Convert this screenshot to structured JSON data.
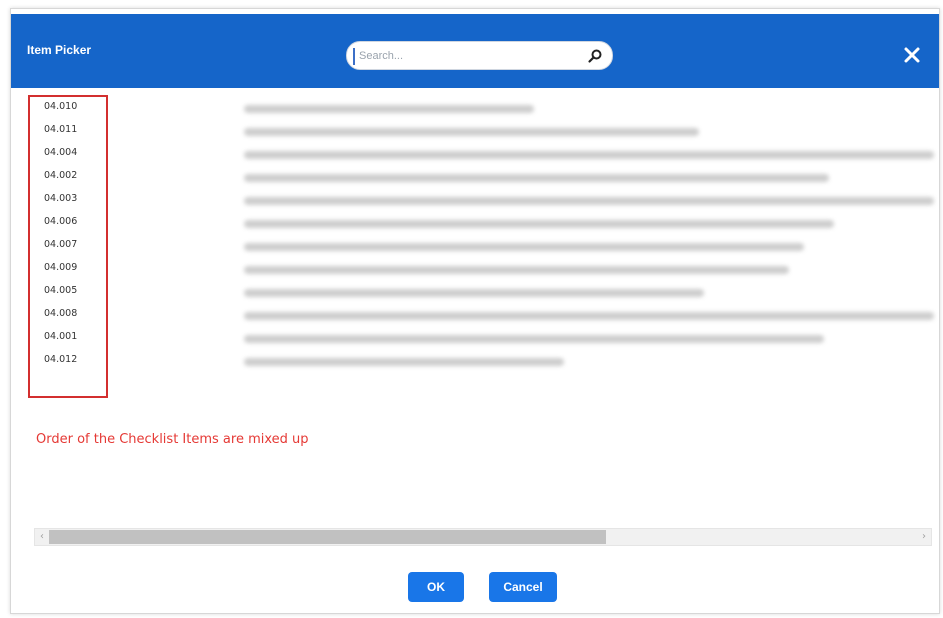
{
  "dialog": {
    "title": "Item Picker",
    "search_placeholder": "Search...",
    "close_label": "✕"
  },
  "items": [
    {
      "code": "04.010"
    },
    {
      "code": "04.011"
    },
    {
      "code": "04.004"
    },
    {
      "code": "04.002"
    },
    {
      "code": "04.003"
    },
    {
      "code": "04.006"
    },
    {
      "code": "04.007"
    },
    {
      "code": "04.009"
    },
    {
      "code": "04.005"
    },
    {
      "code": "04.008"
    },
    {
      "code": "04.001"
    },
    {
      "code": "04.012"
    }
  ],
  "annotation": "Order of the Checklist Items are mixed up",
  "scrollbar": {
    "left_arrow": "‹",
    "right_arrow": "›",
    "position_fraction": 0,
    "visible_fraction": 0.64
  },
  "buttons": {
    "ok": "OK",
    "cancel": "Cancel"
  },
  "colors": {
    "header": "#1565c9",
    "button": "#1976e8",
    "highlight": "#d32f2f",
    "annotation": "#e53935"
  },
  "icons": {
    "search": "search-icon",
    "close": "close-icon"
  }
}
